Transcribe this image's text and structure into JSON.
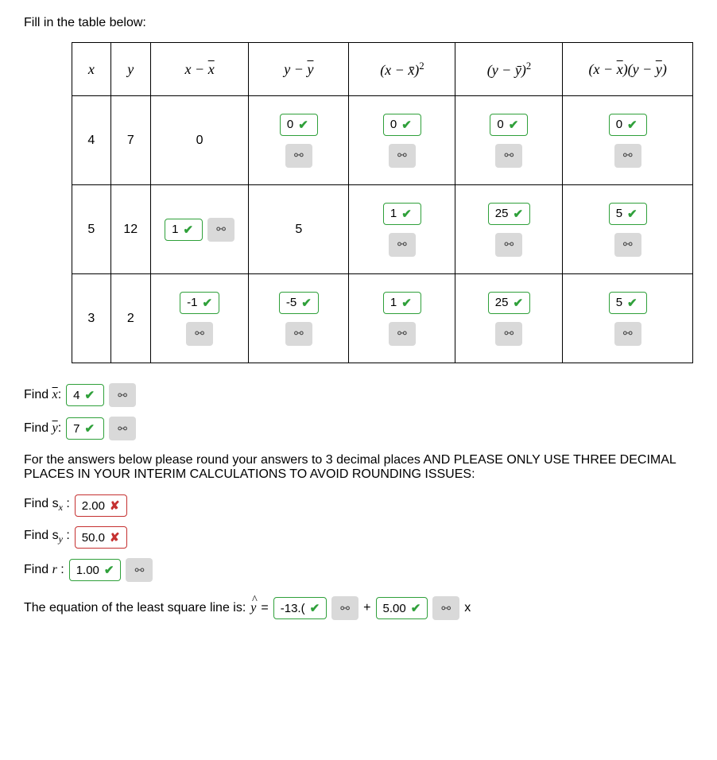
{
  "intro": "Fill in the table below:",
  "headers": {
    "x": "x",
    "y": "y",
    "xx": "x − x̄",
    "yy": "y − ȳ",
    "xx2_a": "(x − x̄)",
    "xx2_b": "2",
    "yy2_a": "(y − ȳ)",
    "yy2_b": "2",
    "xy": "(x − x̄)(y − ȳ)"
  },
  "rows": [
    {
      "x": "4",
      "y": "7",
      "xx": {
        "plain": "0"
      },
      "yy": {
        "val": "0",
        "retry": true
      },
      "xx2": {
        "val": "0",
        "retry": true
      },
      "yy2": {
        "val": "0",
        "retry": true
      },
      "xy": {
        "val": "0",
        "retry": true
      }
    },
    {
      "x": "5",
      "y": "12",
      "xx": {
        "val": "1",
        "retry_inline": true
      },
      "yy": {
        "plain": "5"
      },
      "xx2": {
        "val": "1",
        "retry": true
      },
      "yy2": {
        "val": "25",
        "retry": true
      },
      "xy": {
        "val": "5",
        "retry": true
      }
    },
    {
      "x": "3",
      "y": "2",
      "xx": {
        "val": "-1",
        "retry": true
      },
      "yy": {
        "val": "-5",
        "retry": true
      },
      "xx2": {
        "val": "1",
        "retry": true
      },
      "yy2": {
        "val": "25",
        "retry": true
      },
      "xy": {
        "val": "5",
        "retry": true
      }
    }
  ],
  "find_xbar_label": "Find x̄:",
  "find_xbar_val": "4",
  "find_ybar_label": "Find ȳ:",
  "find_ybar_val": "7",
  "note": "For the answers below please round your answers to 3 decimal places AND PLEASE ONLY USE THREE DECIMAL PLACES IN YOUR INTERIM CALCULATIONS TO AVOID ROUNDING ISSUES:",
  "find_sx_label_a": "Find s",
  "find_sx_label_b": "x",
  "find_sx_label_c": " :",
  "find_sx_val": "2.00",
  "find_sy_label_a": "Find s",
  "find_sy_label_b": "y",
  "find_sy_label_c": " :",
  "find_sy_val": "50.0",
  "find_r_label": "Find r :",
  "find_r_val": "1.00",
  "eq_text": "The equation of the least square line is: ",
  "eq_y": "y",
  "eq_equals": " = ",
  "eq_b": "-13.(",
  "eq_plus": " + ",
  "eq_m": "5.00",
  "eq_x": " x",
  "icons": {
    "check": "✔",
    "cross": "✘",
    "retry": "⚯"
  },
  "chart_data": {
    "type": "table",
    "x": [
      4,
      5,
      3
    ],
    "y": [
      7,
      12,
      2
    ],
    "x_minus_xbar": [
      0,
      1,
      -1
    ],
    "y_minus_ybar": [
      0,
      5,
      -5
    ],
    "x_minus_xbar_sq": [
      0,
      1,
      1
    ],
    "y_minus_ybar_sq": [
      0,
      25,
      25
    ],
    "product": [
      0,
      5,
      5
    ],
    "xbar": 4,
    "ybar": 7,
    "sx_entered": 2.0,
    "sy_entered": 50.0,
    "r": 1.0,
    "regression_intercept": -13.0,
    "regression_slope": 5.0
  }
}
